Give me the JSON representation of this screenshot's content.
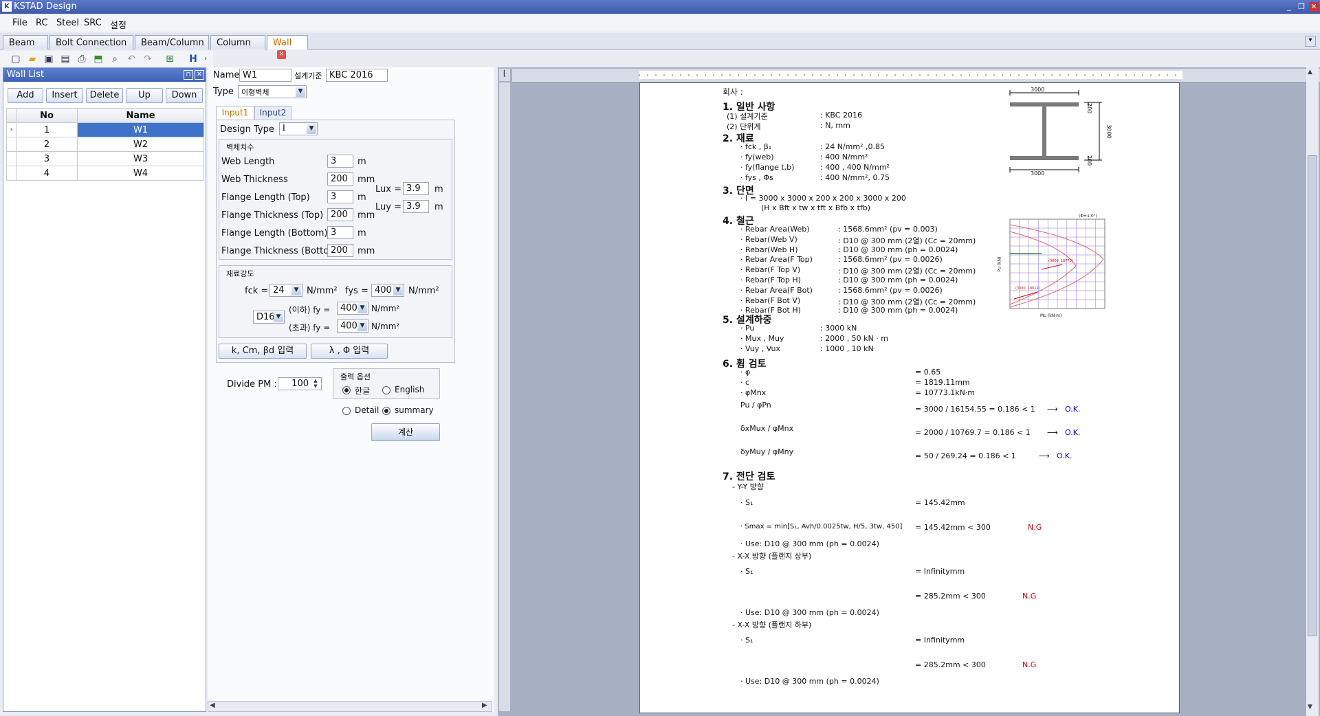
{
  "window": {
    "title": "KSTAD Design"
  },
  "menu": [
    "File",
    "RC",
    "Steel",
    "SRC",
    "설정"
  ],
  "tabs": [
    "Beam",
    "Bolt Connection",
    "Beam/Column",
    "Column",
    "Wall"
  ],
  "wall_list": {
    "title": "Wall List",
    "buttons": [
      "Add",
      "Insert",
      "Delete",
      "Up",
      "Down"
    ],
    "columns": [
      "No",
      "Name"
    ],
    "rows": [
      [
        "1",
        "W1"
      ],
      [
        "2",
        "W2"
      ],
      [
        "3",
        "W3"
      ],
      [
        "4",
        "W4"
      ]
    ]
  },
  "form": {
    "name_label": "Name",
    "name_value": "W1",
    "code_label": "설계기준",
    "code_value": "KBC 2016",
    "type_label": "Type",
    "type_value": "이형벽체",
    "subtabs": [
      "Input1",
      "Input2"
    ],
    "design_type_label": "Design Type",
    "design_type_value": "I",
    "dim_group": "벽체치수",
    "web_length": {
      "label": "Web Length",
      "value": "3",
      "unit": "m"
    },
    "web_thickness": {
      "label": "Web Thickness",
      "value": "200",
      "unit": "mm"
    },
    "flange_length_top": {
      "label": "Flange Length (Top)",
      "value": "3",
      "unit": "m"
    },
    "flange_thickness_top": {
      "label": "Flange Thickness (Top)",
      "value": "200",
      "unit": "mm"
    },
    "flange_length_bottom": {
      "label": "Flange Length (Bottom)",
      "value": "3",
      "unit": "m"
    },
    "flange_thickness_bottom": {
      "label": "Flange Thickness (Bottom)",
      "value": "200",
      "unit": "mm"
    },
    "lux": {
      "label": "Lux =",
      "value": "3.9",
      "unit": "m"
    },
    "luy": {
      "label": "Luy =",
      "value": "3.9",
      "unit": "m"
    },
    "mat_group": "재료강도",
    "fck": {
      "label": "fck =",
      "value": "24",
      "unit": "N/mm²"
    },
    "fys": {
      "label": "fys =",
      "value": "400",
      "unit": "N/mm²"
    },
    "bar": "D16",
    "fy_under": {
      "label": "(이하) fy =",
      "value": "400",
      "unit": "N/mm²"
    },
    "fy_over": {
      "label": "(초과) fy =",
      "value": "400",
      "unit": "N/mm²"
    },
    "btn_k": "k, Cm, βd 입력",
    "btn_lambda": "λ , Φ 입력",
    "divide_label": "Divide PM :",
    "divide_value": "100",
    "output_group": "출력 옵션",
    "opt_korean": "한글",
    "opt_english": "English",
    "opt_detail": "Detail",
    "opt_summary": "summary",
    "calc": "계산"
  },
  "report": {
    "company": "회사      :",
    "s1": "1. 일반 사항",
    "s1a": "(1) 설계기준",
    "s1a_v": ":  KBC 2016",
    "s1b": "(2) 단위계",
    "s1b_v": ":  N, mm",
    "s2": "2. 재료",
    "s2a": "· fck , β₁",
    "s2a_v": ":  24 N/mm² ,0.85",
    "s2b": "· fy(web)",
    "s2b_v": ":  400 N/mm²",
    "s2c": "· fy(flange t,b)",
    "s2c_v": ":  400 , 400 N/mm²",
    "s2d": "· fys , Φs",
    "s2d_v": ":  400 N/mm², 0.75",
    "s3": "3. 단면",
    "s3a": "· I = 3000 x 3000 x 200 x 200 x 3000 x 200",
    "s3b": "(H x Bft x tw x tft x Bfb x tfb)",
    "s4": "4. 철근",
    "rebar": [
      [
        "· Rebar Area(Web)",
        ":  1568.6mm² (pv = 0.003)"
      ],
      [
        "· Rebar(Web V)",
        ":  D10 @ 300 mm  (2열)  (Cc = 20mm)"
      ],
      [
        "· Rebar(Web H)",
        ":  D10 @ 300 mm  (ph = 0.0024)"
      ],
      [
        "· Rebar Area(F Top)",
        ":  1568.6mm² (pv = 0.0026)"
      ],
      [
        "· Rebar(F Top V)",
        ":  D10 @ 300 mm  (2열)  (Cc = 20mm)"
      ],
      [
        "· Rebar(F Top H)",
        ":  D10 @ 300 mm  (ph = 0.0024)"
      ],
      [
        "· Rebar Area(F Bot)",
        ":  1568.6mm² (pv = 0.0026)"
      ],
      [
        "· Rebar(F Bot V)",
        ":  D10 @ 300 mm  (2열)  (Cc = 20mm)"
      ],
      [
        "· Rebar(F Bot H)",
        ":  D10 @ 300 mm  (ph = 0.0024)"
      ]
    ],
    "s5": "5. 설계하중",
    "loads": [
      [
        "· Pu",
        ":  3000 kN"
      ],
      [
        "· Mux , Muy",
        ":  2000 , 50 kN · m"
      ],
      [
        "· Vuy , Vux",
        ":  1000 , 10 kN"
      ]
    ],
    "s6": "6. 휨 검토",
    "flex": [
      [
        "· φ",
        "=  0.65"
      ],
      [
        "· c",
        "=  1819.11mm"
      ],
      [
        "· φMnx",
        "=  10773.1kN·m"
      ]
    ],
    "flex_pu": "Pu / φPn",
    "flex_pu_v": "=  3000 / 16154.55 = 0.186  <  1",
    "ok": "O.K.",
    "flex_mx": "δxMux / φMnx",
    "flex_mx_v": "=  2000 / 10769.7 = 0.186  <  1",
    "flex_my": "δyMuy / φMny",
    "flex_my_v": "=  50 / 269.24 = 0.186  <  1",
    "s7": "7. 전단 검토",
    "yy": "- Y-Y 방향",
    "s1_label": "· S₁",
    "yy_s1": "=  145.42mm",
    "smax_label": "· Smax = min[S₁, Avh/0.0025tw, H/5, 3tw, 450]",
    "yy_smax": "=  145.42mm  <  300",
    "ng": "N.G",
    "use1": "· Use: D10 @ 300 mm (ph = 0.0024)",
    "xxt": "- X-X 방향 (플랜지 상부)",
    "xxt_s1": "=  Infinitymm",
    "xxt_smax": "=  285.2mm  <  300",
    "use2": "· Use: D10 @ 300 mm (ph = 0.0024)",
    "xxb": "- X-X 방향 (플랜지 하부)",
    "xxb_s1": "=  Infinitymm",
    "xxb_smax": "=  285.2mm  <  300",
    "use3": "· Use: D10 @ 300 mm (ph = 0.0024)",
    "dim_3000_top": "3000",
    "dim_3000_bot": "3000",
    "dim_3000_side": "3000",
    "dim_200_top": "200",
    "dim_200_bot": "200",
    "pm_label": "(Φ=1.0°)",
    "pm_x": "Mu (kN·m)",
    "pm_y": "Pu (kN)",
    "pm_pt1": "(3000, 10773)",
    "pm_pt2": "(3000, 10611)"
  }
}
